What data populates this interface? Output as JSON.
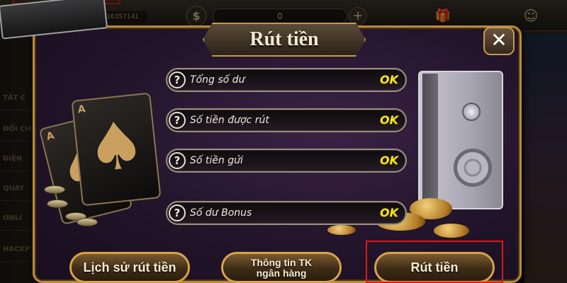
{
  "background": {
    "player_id": "16357141",
    "currency_symbol": "$",
    "balance": "0",
    "plus": "+",
    "side_items": [
      "TẤT C",
      "ĐỔI CH",
      "ĐIỆN",
      "QUAY",
      "ONLI",
      "HACKP"
    ]
  },
  "modal": {
    "title": "Rút tiền",
    "close": "✕",
    "help_glyph": "?",
    "rows": [
      {
        "label": "Tổng số dư",
        "status": "OK"
      },
      {
        "label": "Số tiền được rút",
        "status": "OK"
      },
      {
        "label": "Số tiền gửi",
        "status": "OK"
      },
      {
        "label": "Số dư Bonus",
        "status": "OK"
      }
    ],
    "buttons": {
      "history": "Lịch sử rút tiền",
      "bank_line1": "Thông tin TK",
      "bank_line2": "ngân hàng",
      "withdraw": "Rút tiền"
    }
  },
  "colors": {
    "accent_gold": "#d6a24c",
    "ok_yellow": "#f2e31a",
    "highlight_red": "#e01818"
  },
  "icons": [
    "close-icon",
    "help-icon",
    "spade-card-icon",
    "safe-icon",
    "gift-icon",
    "smile-icon"
  ]
}
